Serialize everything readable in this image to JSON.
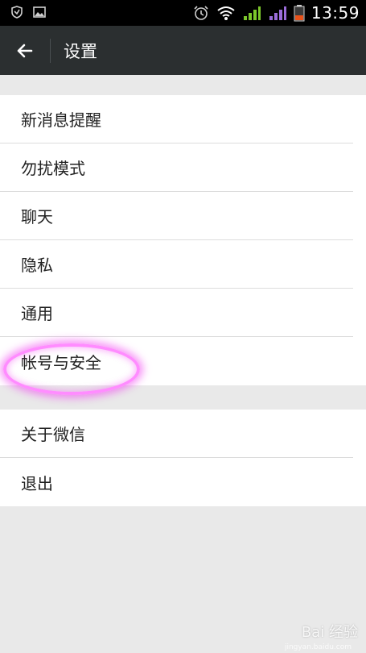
{
  "status_bar": {
    "time": "13:59",
    "icons": [
      "shield-icon",
      "image-icon",
      "alarm-icon",
      "wifi-icon",
      "signal-3g-icon",
      "signal-2g-icon",
      "battery-icon"
    ],
    "signal_color": "#7cc72b",
    "battery_color": "#e8521a"
  },
  "header": {
    "title": "设置",
    "back_icon": "arrow-left-icon"
  },
  "settings": {
    "group_1": [
      {
        "label": "新消息提醒"
      },
      {
        "label": "勿扰模式"
      },
      {
        "label": "聊天"
      },
      {
        "label": "隐私"
      },
      {
        "label": "通用"
      },
      {
        "label": "帐号与安全"
      }
    ],
    "group_2": [
      {
        "label": "关于微信"
      },
      {
        "label": "退出"
      }
    ]
  },
  "colors": {
    "title_bar": "#2b2f30",
    "background": "#e9e9e9",
    "highlight": "#ff8cff"
  },
  "watermark": {
    "text": "Bai 经验",
    "sub": "jingyan.baidu.com"
  }
}
